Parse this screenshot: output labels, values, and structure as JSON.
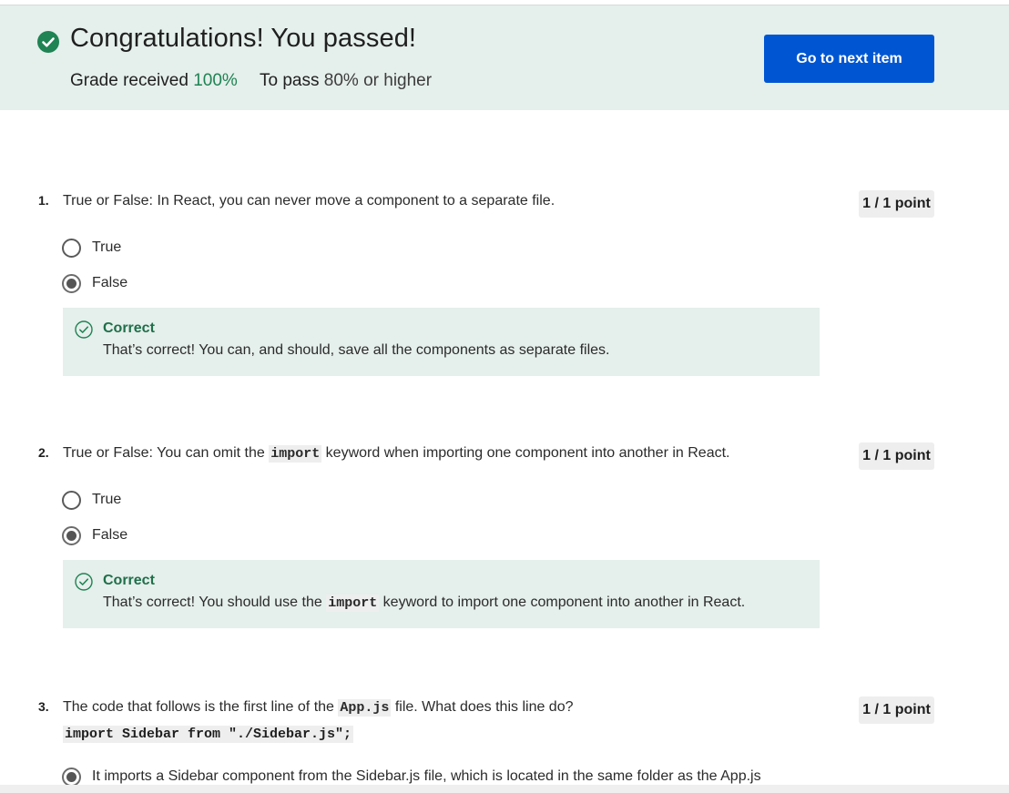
{
  "banner": {
    "title": "Congratulations! You passed!",
    "grade_label": "Grade received",
    "grade_value": "100%",
    "pass_label": "To pass",
    "pass_value": "80% or higher",
    "next_button": "Go to next item"
  },
  "questions": [
    {
      "number": "1.",
      "text": "True or False: In React, you can never move a component to a separate file.",
      "points": "1 / 1 point",
      "options": [
        {
          "label": "True",
          "selected": false
        },
        {
          "label": "False",
          "selected": true
        }
      ],
      "feedback": {
        "title": "Correct",
        "text": "That’s correct! You can, and should, save all the components as separate files."
      }
    },
    {
      "number": "2.",
      "text_before": "True or False: You can omit the ",
      "text_code": "import",
      "text_after": " keyword when importing one component into another in React.",
      "points": "1 / 1 point",
      "options": [
        {
          "label": "True",
          "selected": false
        },
        {
          "label": "False",
          "selected": true
        }
      ],
      "feedback": {
        "title": "Correct",
        "text_before": "That’s correct! You should use the ",
        "text_code": "import",
        "text_after": " keyword to import one component into another in React."
      }
    },
    {
      "number": "3.",
      "text_before": "The code that follows is the first line of the ",
      "text_code": "App.js",
      "text_after": " file. What does this line do?",
      "code_line": "import Sidebar from \"./Sidebar.js\";",
      "points": "1 / 1 point",
      "options": [
        {
          "label": "It imports a Sidebar component from the Sidebar.js file, which is located in the same folder as the App.js",
          "selected": true
        }
      ]
    }
  ],
  "colors": {
    "accent": "#0056d2",
    "success": "#1f8354",
    "banner_bg": "#e5efeb"
  }
}
